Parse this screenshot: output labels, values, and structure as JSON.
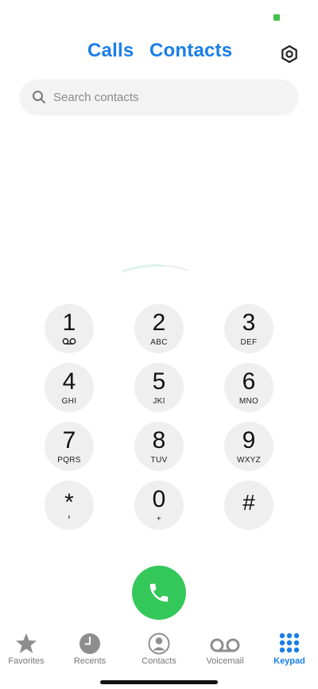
{
  "header": {
    "tabs": [
      {
        "label": "Calls"
      },
      {
        "label": "Contacts"
      }
    ],
    "settings_icon": "settings-hexagon-icon"
  },
  "search": {
    "placeholder": "Search contacts",
    "value": ""
  },
  "keypad": {
    "keys": [
      {
        "digit": "1",
        "letters": "",
        "sub_icon": "voicemail-icon"
      },
      {
        "digit": "2",
        "letters": "ABC"
      },
      {
        "digit": "3",
        "letters": "DEF"
      },
      {
        "digit": "4",
        "letters": "GHI"
      },
      {
        "digit": "5",
        "letters": "JKI"
      },
      {
        "digit": "6",
        "letters": "MNO"
      },
      {
        "digit": "7",
        "letters": "PQRS"
      },
      {
        "digit": "8",
        "letters": "TUV"
      },
      {
        "digit": "9",
        "letters": "WXYZ"
      },
      {
        "digit": "*",
        "letters": ","
      },
      {
        "digit": "0",
        "letters": "+"
      },
      {
        "digit": "#",
        "letters": ""
      }
    ]
  },
  "call_button": {
    "icon": "phone-icon",
    "color": "#34c759"
  },
  "tabbar": {
    "items": [
      {
        "label": "Favorites",
        "icon": "star-icon",
        "active": false
      },
      {
        "label": "Recents",
        "icon": "clock-icon",
        "active": false
      },
      {
        "label": "Contacts",
        "icon": "person-circle-icon",
        "active": false
      },
      {
        "label": "Voicemail",
        "icon": "voicemail-icon",
        "active": false
      },
      {
        "label": "Keypad",
        "icon": "keypad-grid-icon",
        "active": true
      }
    ]
  },
  "colors": {
    "accent": "#1a7ee8",
    "call_green": "#34c759",
    "key_bg": "#efefef",
    "inactive_icon": "#8e8e8e"
  }
}
